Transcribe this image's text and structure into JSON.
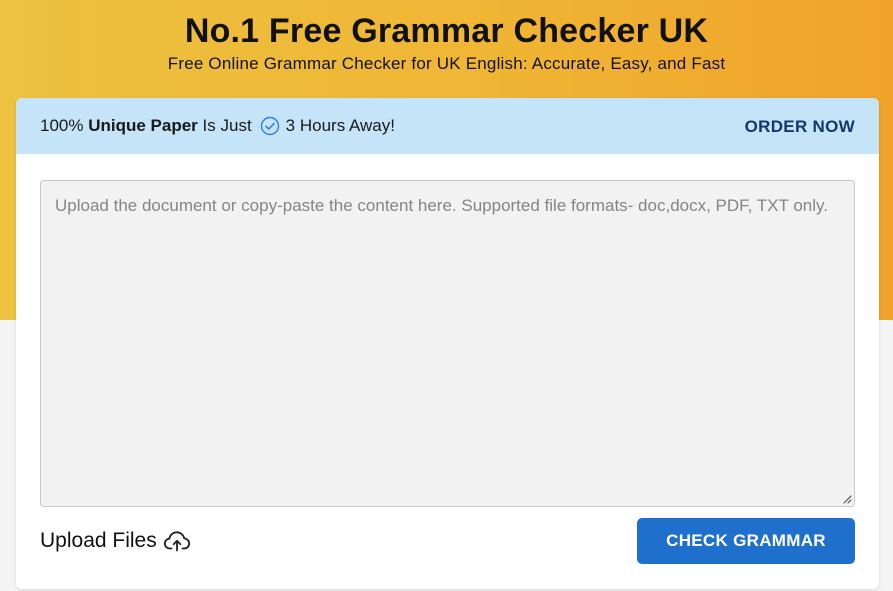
{
  "header": {
    "title": "No.1 Free Grammar Checker UK",
    "subtitle": "Free Online Grammar Checker for UK English: Accurate, Easy, and Fast"
  },
  "promo": {
    "prefix": "100%",
    "highlight": "Unique Paper",
    "middle": "Is Just",
    "suffix": "3 Hours Away!",
    "icon": "check-circle-icon",
    "order_now": "ORDER NOW"
  },
  "editor": {
    "value": "",
    "placeholder": "Upload the document or copy-paste the content here. Supported file formats- doc,docx, PDF, TXT only."
  },
  "actions": {
    "upload_label": "Upload Files",
    "upload_icon": "cloud-upload-icon",
    "check_label": "CHECK GRAMMAR"
  },
  "colors": {
    "hero_gradient_start": "#ecc240",
    "hero_gradient_end": "#f0a32a",
    "promo_bar": "#c6e4f7",
    "order_now_text": "#13386a",
    "primary_button": "#1f6fcc"
  }
}
